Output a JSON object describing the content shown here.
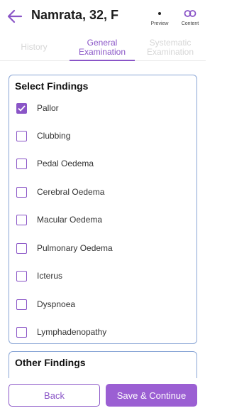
{
  "header": {
    "title": "Namrata, 32, F",
    "preview_label": "Preview",
    "content_label": "Content"
  },
  "tabs": [
    {
      "label": "History",
      "state": "inactive"
    },
    {
      "label": "General Examination",
      "state": "active"
    },
    {
      "label": "Systematic Examination",
      "state": "inactive"
    }
  ],
  "findings": {
    "title": "Select Findings",
    "items": [
      {
        "label": "Pallor",
        "checked": true
      },
      {
        "label": "Clubbing",
        "checked": false
      },
      {
        "label": "Pedal Oedema",
        "checked": false
      },
      {
        "label": "Cerebral Oedema",
        "checked": false
      },
      {
        "label": "Macular Oedema",
        "checked": false
      },
      {
        "label": "Pulmonary Oedema",
        "checked": false
      },
      {
        "label": "Icterus",
        "checked": false
      },
      {
        "label": "Dyspnoea",
        "checked": false
      },
      {
        "label": "Lymphadenopathy",
        "checked": false
      }
    ]
  },
  "other_findings": {
    "title": "Other Findings"
  },
  "footer": {
    "back_label": "Back",
    "save_label": "Save & Continue"
  },
  "colors": {
    "accent": "#8a55c7",
    "primary_button": "#9b5fd3",
    "card_border": "#8aa6d6"
  }
}
